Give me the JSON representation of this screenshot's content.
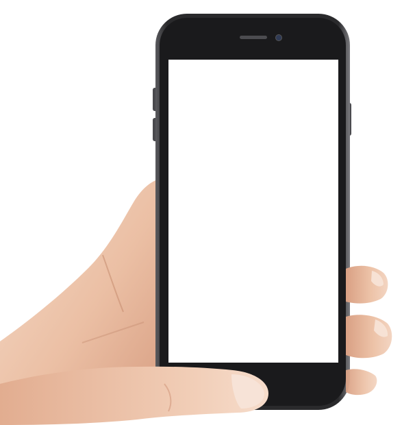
{
  "scene": {
    "subject": "hand-holding-smartphone",
    "screen_state": "blank-white"
  },
  "colors": {
    "background": "#ffffff",
    "phone_body": "#1c1c1e",
    "phone_frame_edge": "#6e6e72",
    "screen": "#ffffff",
    "skin_light": "#f2d2bd",
    "skin_mid": "#e6b79b",
    "skin_shadow": "#c98f73",
    "nail": "#f7e4d8"
  },
  "icons": {
    "earpiece": "speaker-grille-icon",
    "front_camera": "front-camera-icon"
  }
}
